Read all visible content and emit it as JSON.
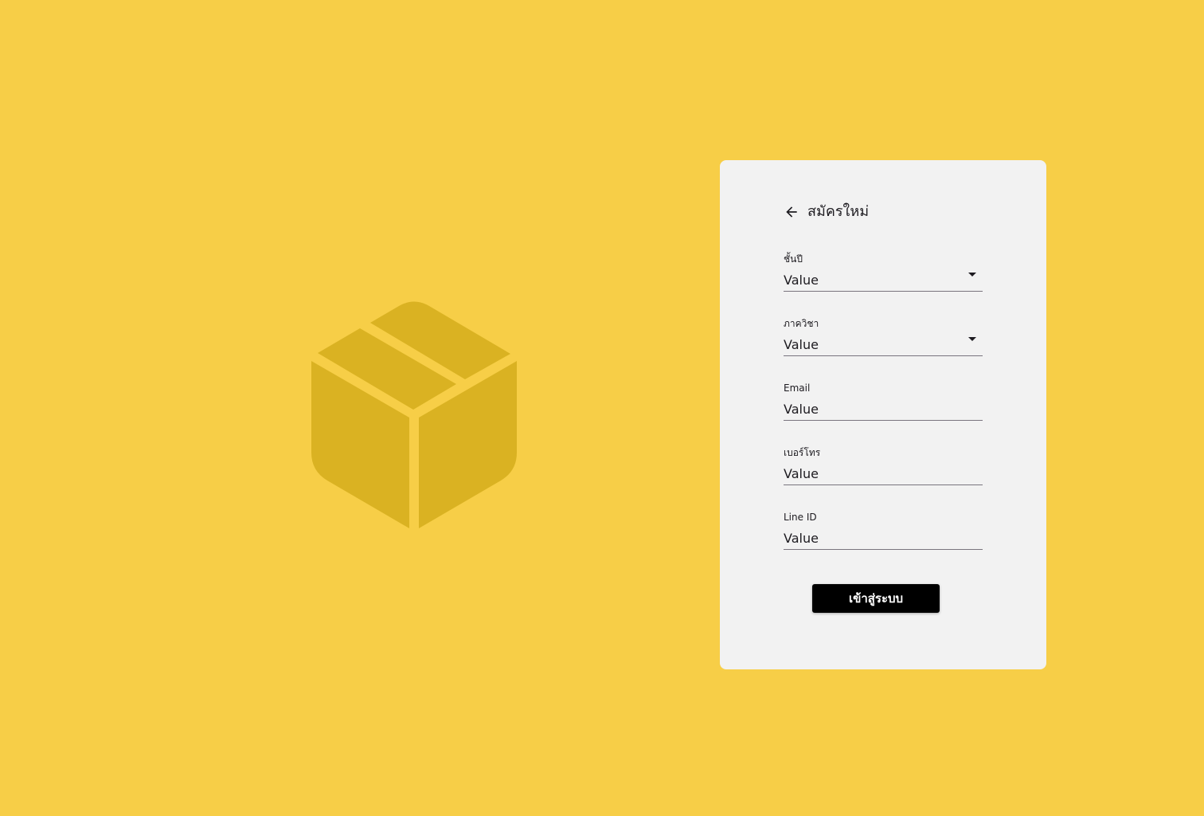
{
  "colors": {
    "background": "#F7CE47",
    "logo": "#DAB222",
    "card": "#F2F2F2",
    "button": "#000000",
    "button_text": "#FFFFFF"
  },
  "logo": {
    "icon": "package-box-icon"
  },
  "form": {
    "back_icon": "arrow-left-icon",
    "title": "สมัครใหม่",
    "fields": [
      {
        "label": "ชั้นปี",
        "value": "Value",
        "type": "select",
        "icon": "caret-down-icon"
      },
      {
        "label": "ภาควิชา",
        "value": "Value",
        "type": "select",
        "icon": "caret-down-icon"
      },
      {
        "label": "Email",
        "value": "Value",
        "type": "text"
      },
      {
        "label": "เบอร์โทร",
        "value": "Value",
        "type": "text"
      },
      {
        "label": "Line ID",
        "value": "Value",
        "type": "text"
      }
    ],
    "submit_label": "เข้าสู่ระบบ"
  }
}
